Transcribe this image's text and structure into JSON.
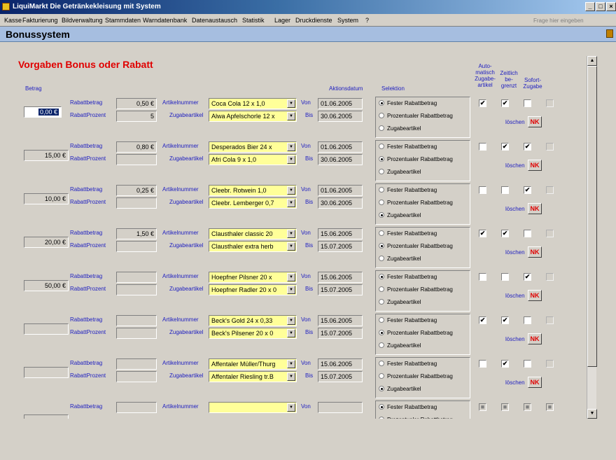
{
  "window": {
    "title": "LiquiMarkt Die Getränkekleisung mit System",
    "controls": [
      "_",
      "□",
      "×"
    ]
  },
  "menu": {
    "items": [
      "Kasse",
      "Fakturierung",
      "Bildverwaltung",
      "Stammdaten",
      "Warndatenbank",
      "Datenaustausch",
      "Statistik",
      "Lager",
      "Druckdienste",
      "System",
      "?"
    ],
    "help_placeholder": "Frage hier eingeben"
  },
  "form": {
    "title": "Bonussystem",
    "heading": "Vorgaben Bonus oder Rabatt",
    "col_betrag": "Betrag",
    "col_aktionsdatum": "Aktionsdatum",
    "col_selektion": "Selektion",
    "col_auto": "Auto-matisch Zugabe-artikel",
    "col_zeitlich": "Zeitlich be-grenzt",
    "col_sofort": "Sofort-Zugabe",
    "lbl_rabattbetrag": "Rabattbetrag",
    "lbl_rabattprozent": "RabattProzent",
    "lbl_artikelnummer": "Artikelnummer",
    "lbl_zugabeartikel": "Zugabeartikel",
    "lbl_von": "Von",
    "lbl_bis": "Bis",
    "opt_fester": "Fester Rabattbetrag",
    "opt_prozent": "Prozentualer Rabattbetrag",
    "opt_zugabe": "Zugabeartikel",
    "lbl_loeschen": "löschen",
    "nk_label": "NK"
  },
  "rows": [
    {
      "betrag": "0,00 €",
      "rabattbetrag": "0,50 €",
      "rabattprozent": "5",
      "artikel": "Coca Cola 12 x 1,0",
      "zugabe": "Alwa Apfelschorle 12 x",
      "von": "01.06.2005",
      "bis": "30.06.2005",
      "selektion": 0,
      "auto": "✔",
      "zeitlich": "✔",
      "sofort": "",
      "extra": ""
    },
    {
      "betrag": "15,00 €",
      "rabattbetrag": "0,80 €",
      "rabattprozent": "",
      "artikel": "Desperados Bier 24 x",
      "zugabe": "Afri Cola 9 x 1,0",
      "von": "01.06.2005",
      "bis": "30.06.2005",
      "selektion": 1,
      "auto": "",
      "zeitlich": "✔",
      "sofort": "✔",
      "extra": ""
    },
    {
      "betrag": "10,00 €",
      "rabattbetrag": "0,25 €",
      "rabattprozent": "",
      "artikel": "Cleebr. Rotwein 1,0",
      "zugabe": "Cleebr. Lemberger 0,7",
      "von": "01.06.2005",
      "bis": "30.06.2005",
      "selektion": 2,
      "auto": "",
      "zeitlich": "",
      "sofort": "✔",
      "extra": ""
    },
    {
      "betrag": "20,00 €",
      "rabattbetrag": "1,50 €",
      "rabattprozent": "",
      "artikel": "Clausthaler classic 20",
      "zugabe": "Clausthaler extra herb",
      "von": "15.06.2005",
      "bis": "15.07.2005",
      "selektion": 1,
      "auto": "✔",
      "zeitlich": "✔",
      "sofort": "",
      "extra": ""
    },
    {
      "betrag": "50,00 €",
      "rabattbetrag": "",
      "rabattprozent": "",
      "artikel": "Hoepfner Pilsner 20 x",
      "zugabe": "Hoepfner Radler 20 x 0",
      "von": "15.06.2005",
      "bis": "15.07.2005",
      "selektion": 0,
      "auto": "",
      "zeitlich": "",
      "sofort": "✔",
      "extra": ""
    },
    {
      "betrag": "",
      "rabattbetrag": "",
      "rabattprozent": "",
      "artikel": "Beck's Gold 24 x 0,33",
      "zugabe": "Beck's Pilsener 20 x 0",
      "von": "15.06.2005",
      "bis": "15.07.2005",
      "selektion": 1,
      "auto": "✔",
      "zeitlich": "✔",
      "sofort": "",
      "extra": ""
    },
    {
      "betrag": "",
      "rabattbetrag": "",
      "rabattprozent": "",
      "artikel": "Affentaler Müller/Thurg",
      "zugabe": "Affentaler Riesling tr.B",
      "von": "15.06.2005",
      "bis": "15.07.2005",
      "selektion": 2,
      "auto": "",
      "zeitlich": "✔",
      "sofort": "",
      "extra": ""
    }
  ],
  "last_row": {
    "betrag": "",
    "rabattbetrag": "",
    "artikel": "",
    "von": "",
    "selektion": 0,
    "marks": [
      "■",
      "■",
      "■",
      "■"
    ]
  }
}
